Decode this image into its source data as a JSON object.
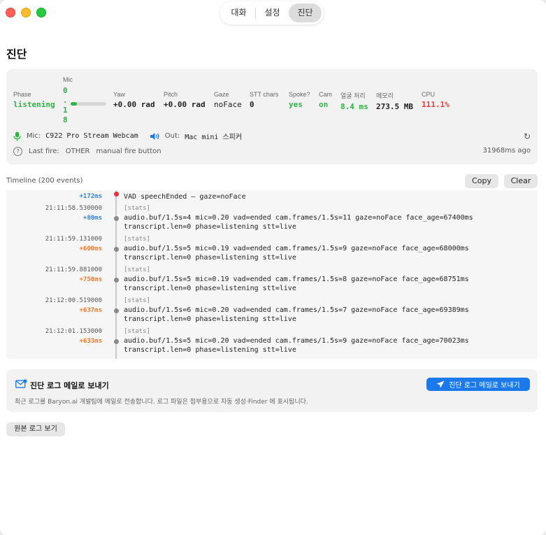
{
  "segmented": {
    "items": [
      "대화",
      "설정",
      "진단"
    ],
    "active_index": 2
  },
  "page_title": "진단",
  "stats": {
    "phase": {
      "label": "Phase",
      "value": "listening"
    },
    "mic": {
      "label": "Mic",
      "digits": [
        "0",
        ".",
        "1",
        "8"
      ],
      "level": 0.18
    },
    "yaw": {
      "label": "Yaw",
      "value": "+0.00 rad"
    },
    "pitch": {
      "label": "Pitch",
      "value": "+0.00 rad"
    },
    "gaze": {
      "label": "Gaze",
      "value": "noFace"
    },
    "stt_chars": {
      "label": "STT chars",
      "value": "0"
    },
    "spoke": {
      "label": "Spoke?",
      "value": "yes"
    },
    "cam": {
      "label": "Cam",
      "value": "on"
    },
    "face_proc": {
      "label": "얼굴 처리",
      "value": "8.4 ms"
    },
    "memory": {
      "label": "메모리",
      "value": "273.5 MB"
    },
    "cpu": {
      "label": "CPU",
      "value": "111.1%"
    }
  },
  "devices": {
    "mic_label": "Mic:",
    "mic_value": "C922 Pro Stream Webcam",
    "out_label": "Out:",
    "out_value": "Mac mini 스피커"
  },
  "last_fire": {
    "label": "Last fire:",
    "kind": "OTHER",
    "reason": "manual fire button",
    "ago": "31968ms ago"
  },
  "timeline": {
    "label": "Timeline (200 events)",
    "copy_label": "Copy",
    "clear_label": "Clear",
    "events": [
      {
        "ts": "",
        "delta": "+172ms",
        "delta_color": "blue",
        "dot": "red",
        "tag": "",
        "lines": [
          "VAD speechEnded — gaze=noFace"
        ]
      },
      {
        "ts": "21:11:58.530000",
        "delta": "+80ms",
        "delta_color": "blue",
        "dot": "gray",
        "tag": "[stats]",
        "lines": [
          "audio.buf/1.5s=4 mic=0.20 vad=ended cam.frames/1.5s=11 gaze=noFace face_age=67400ms",
          "transcript.len=0 phase=listening stt=live"
        ]
      },
      {
        "ts": "21:11:59.131000",
        "delta": "+600ms",
        "delta_color": "orange",
        "dot": "gray",
        "tag": "[stats]",
        "lines": [
          "audio.buf/1.5s=5 mic=0.19 vad=ended cam.frames/1.5s=9 gaze=noFace face_age=68000ms",
          "transcript.len=0 phase=listening stt=live"
        ]
      },
      {
        "ts": "21:11:59.881000",
        "delta": "+750ms",
        "delta_color": "orange",
        "dot": "gray",
        "tag": "[stats]",
        "lines": [
          "audio.buf/1.5s=5 mic=0.19 vad=ended cam.frames/1.5s=8 gaze=noFace face_age=68751ms",
          "transcript.len=0 phase=listening stt=live"
        ]
      },
      {
        "ts": "21:12:00.519000",
        "delta": "+637ms",
        "delta_color": "orange",
        "dot": "gray",
        "tag": "[stats]",
        "lines": [
          "audio.buf/1.5s=6 mic=0.20 vad=ended cam.frames/1.5s=7 gaze=noFace face_age=69389ms",
          "transcript.len=0 phase=listening stt=live"
        ]
      },
      {
        "ts": "21:12:01.153000",
        "delta": "+633ms",
        "delta_color": "orange",
        "dot": "gray",
        "tag": "[stats]",
        "lines": [
          "audio.buf/1.5s=5 mic=0.20 vad=ended cam.frames/1.5s=9 gaze=noFace face_age=70023ms",
          "transcript.len=0 phase=listening stt=live"
        ]
      }
    ]
  },
  "email": {
    "title": "진단 로그 메일로 보내기",
    "description": "최근 로그를 Baryon.ai 개발팀에 메일로 전송합니다. 로그 파일은 첨부용으로 자동 생성·Finder 에 표시됩니다.",
    "button_label": "진단 로그 메일로 보내기"
  },
  "raw_log_label": "원본 로그 보기",
  "colors": {
    "accent": "#1a7aeb",
    "green": "#2fb344",
    "red": "#f03a3a",
    "orange": "#f07a2a",
    "blue": "#2f80e0"
  },
  "icons": [
    "mic-icon",
    "speaker-icon",
    "refresh-icon",
    "help-icon",
    "mail-icon",
    "send-icon"
  ]
}
